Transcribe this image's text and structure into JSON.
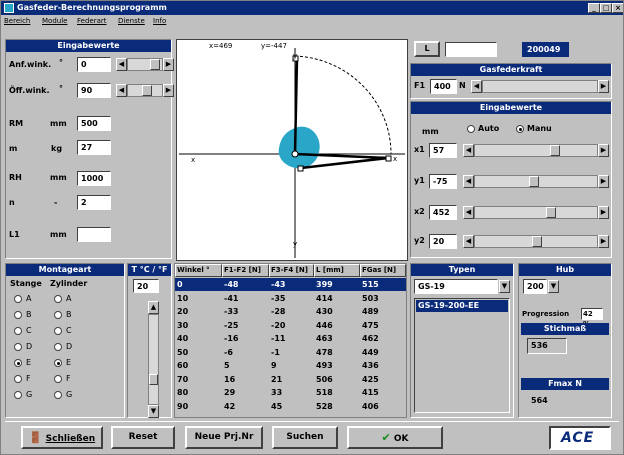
{
  "window": {
    "title": "Gasfeder-Berechnungsprogramm"
  },
  "menu": [
    "Bereich",
    "Module",
    "Federart",
    "Dienste",
    "Info"
  ],
  "eingabewerte_left": {
    "header": "Eingabewerte",
    "rows": [
      {
        "label": "Anf.wink.",
        "unit": "°",
        "value": "0"
      },
      {
        "label": "Öff.wink.",
        "unit": "°",
        "value": "90"
      },
      {
        "label": "RM",
        "unit": "mm",
        "value": "500"
      },
      {
        "label": "m",
        "unit": "kg",
        "value": "27"
      },
      {
        "label": "RH",
        "unit": "mm",
        "value": "1000"
      },
      {
        "label": "n",
        "unit": "-",
        "value": "2"
      },
      {
        "label": "L1",
        "unit": "mm",
        "value": ""
      }
    ]
  },
  "plot": {
    "coord_x": "x=469",
    "coord_y": "y=-447",
    "label_top": "y",
    "label_bottom": "y",
    "label_left": "x",
    "label_right": "x"
  },
  "top_right": {
    "l_button": "L",
    "l_value": "",
    "code": "200049"
  },
  "gasfederkraft": {
    "header": "Gasfederkraft",
    "f1_label": "F1",
    "f1_value": "400",
    "f1_unit": "N"
  },
  "eingabewerte_right": {
    "header": "Eingabewerte",
    "mm_label": "mm",
    "auto_label": "Auto",
    "manu_label": "Manu",
    "mode": "Manu",
    "rows": [
      {
        "label": "x1",
        "value": "57",
        "level": 0.55
      },
      {
        "label": "y1",
        "value": "-75",
        "level": 0.4
      },
      {
        "label": "x2",
        "value": "452",
        "level": 0.52
      },
      {
        "label": "y2",
        "value": "20",
        "level": 0.42
      }
    ]
  },
  "montageart": {
    "header": "Montageart",
    "col1": "Stange",
    "col2": "Zylinder",
    "options": [
      "A",
      "B",
      "C",
      "D",
      "E",
      "F",
      "G"
    ],
    "stange_selected": "E",
    "zylinder_selected": "E"
  },
  "temperature": {
    "header": "T °C / °F",
    "value": "20",
    "level": 0.75
  },
  "table": {
    "columns": [
      "Winkel °",
      "F1-F2 [N]",
      "F3-F4 [N]",
      "L [mm]",
      "FGas [N]"
    ],
    "rows": [
      [
        "0",
        "-48",
        "-43",
        "399",
        "515"
      ],
      [
        "10",
        "-41",
        "-35",
        "414",
        "503"
      ],
      [
        "20",
        "-33",
        "-28",
        "430",
        "489"
      ],
      [
        "30",
        "-25",
        "-20",
        "446",
        "475"
      ],
      [
        "40",
        "-16",
        "-11",
        "463",
        "462"
      ],
      [
        "50",
        "-6",
        "-1",
        "478",
        "449"
      ],
      [
        "60",
        "5",
        "9",
        "493",
        "436"
      ],
      [
        "70",
        "16",
        "21",
        "506",
        "425"
      ],
      [
        "80",
        "29",
        "33",
        "518",
        "415"
      ],
      [
        "90",
        "42",
        "45",
        "528",
        "406"
      ]
    ]
  },
  "typen": {
    "header": "Typen",
    "selected": "GS-19",
    "items": [
      "GS-19-200-EE"
    ]
  },
  "hub": {
    "header": "Hub",
    "value": "200",
    "progression_label": "Progression",
    "progression_value": "42 %",
    "stichmass_header": "Stichmaß",
    "stichmass_value": "536",
    "fmax_header": "Fmax N",
    "fmax_value": "564"
  },
  "buttons": {
    "schliessen": "Schließen",
    "reset": "Reset",
    "neue_prj": "Neue Prj.Nr",
    "suchen": "Suchen",
    "ok": "OK"
  },
  "logo": "ACE",
  "colors": {
    "titlebar": "#0a2a7a",
    "accent_cyan": "#2aa7c8",
    "panel": "#c0c0c0"
  }
}
